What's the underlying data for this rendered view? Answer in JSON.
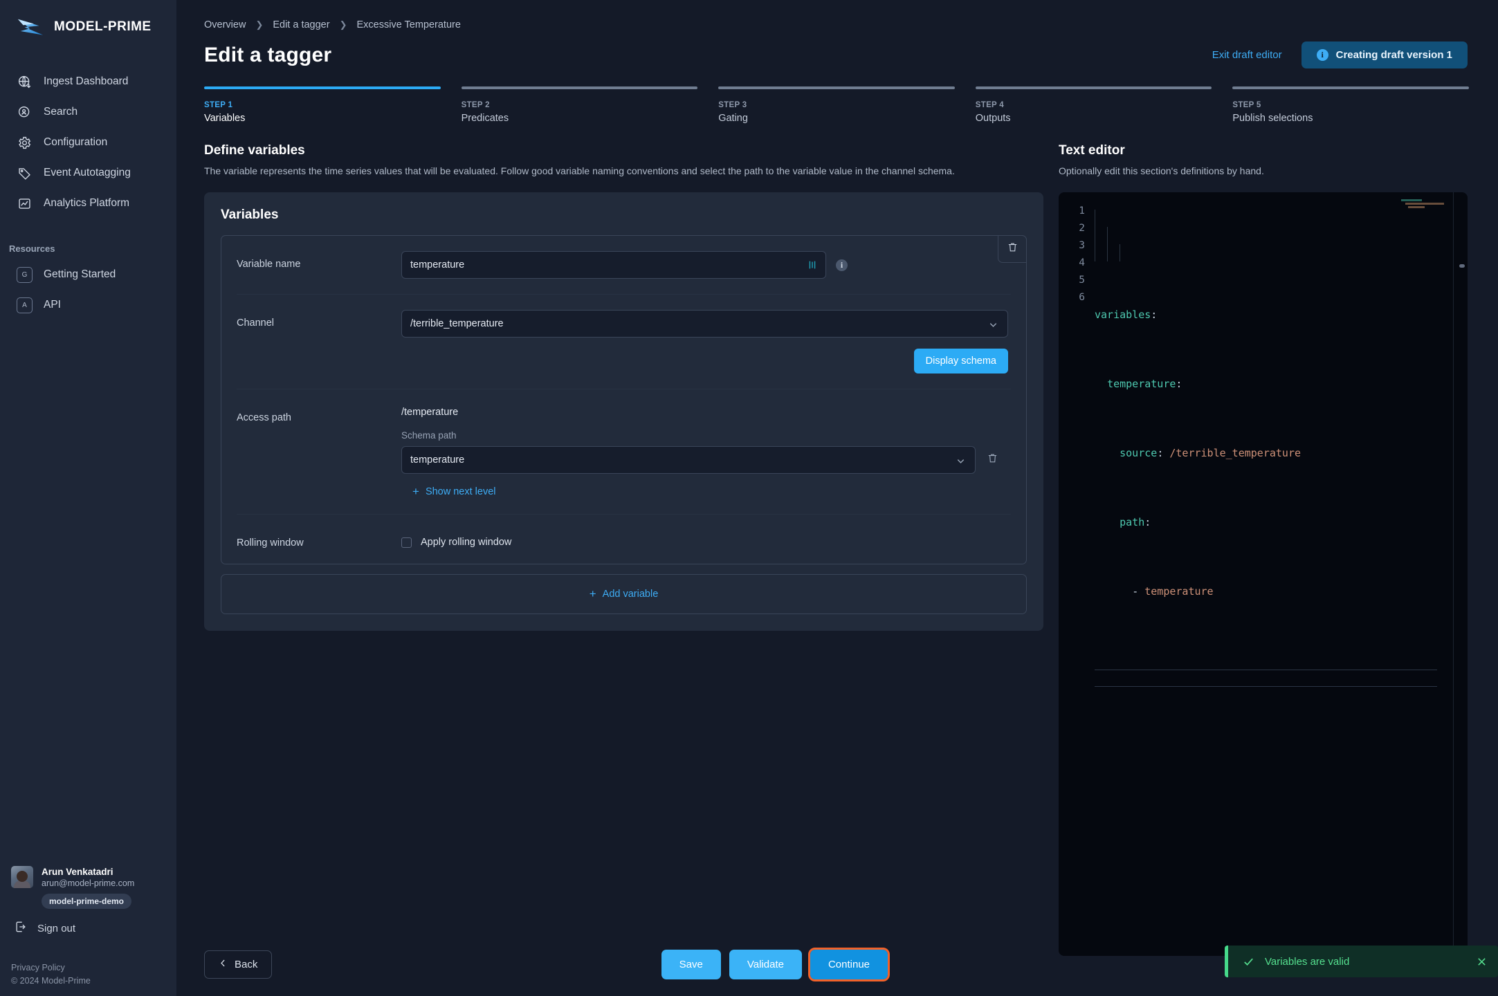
{
  "brand": {
    "name": "MODEL-PRIME",
    "logo_icon": "model-prime-logo-icon"
  },
  "sidebar": {
    "nav": [
      {
        "label": "Ingest Dashboard",
        "icon": "globe-download-icon"
      },
      {
        "label": "Search",
        "icon": "search-person-icon"
      },
      {
        "label": "Configuration",
        "icon": "gear-icon"
      },
      {
        "label": "Event Autotagging",
        "icon": "tag-icon"
      },
      {
        "label": "Analytics Platform",
        "icon": "chart-image-icon"
      }
    ],
    "resources_heading": "Resources",
    "resources": [
      {
        "label": "Getting Started",
        "badge": "G"
      },
      {
        "label": "API",
        "badge": "A"
      }
    ],
    "user": {
      "name": "Arun Venkatadri",
      "email": "arun@model-prime.com",
      "org": "model-prime-demo"
    },
    "signout_label": "Sign out",
    "privacy_label": "Privacy Policy",
    "copyright": "© 2024 Model-Prime"
  },
  "header": {
    "breadcrumb": [
      "Overview",
      "Edit a tagger",
      "Excessive Temperature"
    ],
    "title": "Edit a tagger",
    "exit_link": "Exit draft editor",
    "draft_button": "Creating draft version 1"
  },
  "steps": [
    {
      "num": "STEP 1",
      "name": "Variables",
      "active": true
    },
    {
      "num": "STEP 2",
      "name": "Predicates",
      "active": false
    },
    {
      "num": "STEP 3",
      "name": "Gating",
      "active": false
    },
    {
      "num": "STEP 4",
      "name": "Outputs",
      "active": false
    },
    {
      "num": "STEP 5",
      "name": "Publish selections",
      "active": false
    }
  ],
  "define": {
    "heading": "Define variables",
    "subtitle": "The variable represents the time series values that will be evaluated. Follow good variable naming conventions and select the path to the variable value in the channel schema."
  },
  "variables_card": {
    "title": "Variables",
    "variable_name_label": "Variable name",
    "variable_name_value": "temperature",
    "channel_label": "Channel",
    "channel_value": "/terrible_temperature",
    "display_schema_label": "Display schema",
    "access_path_label": "Access path",
    "access_path_value": "/temperature",
    "schema_path_label": "Schema path",
    "schema_path_value": "temperature",
    "show_next_level_label": "Show next level",
    "rolling_window_label": "Rolling window",
    "apply_rolling_window_label": "Apply rolling window",
    "apply_rolling_window_checked": false,
    "add_variable_label": "Add variable"
  },
  "editor": {
    "heading": "Text editor",
    "subtitle": "Optionally edit this section's definitions by hand.",
    "line_numbers": [
      "1",
      "2",
      "3",
      "4",
      "5",
      "6"
    ],
    "lines": [
      {
        "indent": 0,
        "key": "variables",
        "punct": ":",
        "value": ""
      },
      {
        "indent": 1,
        "key": "temperature",
        "punct": ":",
        "value": ""
      },
      {
        "indent": 2,
        "key": "source",
        "punct": ":",
        "value": "/terrible_temperature"
      },
      {
        "indent": 2,
        "key": "path",
        "punct": ":",
        "value": ""
      },
      {
        "indent": 3,
        "key": "",
        "punct": "-",
        "value": "temperature"
      },
      {
        "indent": 0,
        "key": "",
        "punct": "",
        "value": ""
      }
    ],
    "raw": "variables:\n  temperature:\n    source: /terrible_temperature\n    path:\n      - temperature\n"
  },
  "footer": {
    "back_label": "Back",
    "save_label": "Save",
    "validate_label": "Validate",
    "continue_label": "Continue"
  },
  "toast": {
    "message": "Variables are valid",
    "icon": "check-icon",
    "close_icon": "close-icon"
  },
  "colors": {
    "accent": "#2cabf5",
    "accent_link": "#3eadf5",
    "focus_ring": "#f2622a",
    "success": "#46d98a",
    "sidebar_bg": "#1e2637",
    "page_bg": "#141a28",
    "card_bg": "#222b3b",
    "editor_bg": "#05080f"
  }
}
